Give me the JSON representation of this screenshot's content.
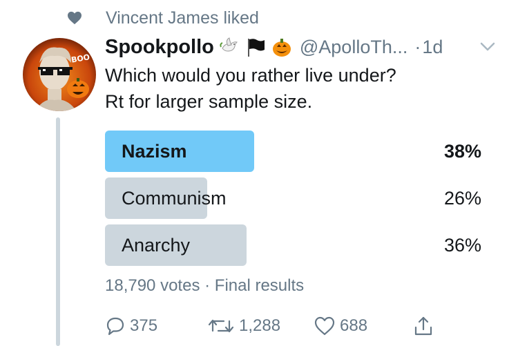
{
  "context": {
    "text": "Vincent James liked",
    "icon": "heart-icon"
  },
  "tweet": {
    "display_name": "Spookpollo",
    "emojis": [
      "dove-emoji",
      "black-flag-emoji",
      "jack-o-lantern-emoji"
    ],
    "handle": "@ApolloTh...",
    "dot": "·",
    "time": "1d",
    "text_line1": "Which would you rather live under?",
    "text_line2": "Rt for larger sample size.",
    "avatar_text": "BOO"
  },
  "poll": {
    "options": [
      {
        "label": "Nazism",
        "percent_label": "38%",
        "percent": 38,
        "winner": true
      },
      {
        "label": "Communism",
        "percent_label": "26%",
        "percent": 26,
        "winner": false
      },
      {
        "label": "Anarchy",
        "percent_label": "36%",
        "percent": 36,
        "winner": false
      }
    ],
    "votes": "18,790 votes",
    "separator": "·",
    "status": "Final results"
  },
  "actions": {
    "replies": "375",
    "retweets": "1,288",
    "likes": "688"
  },
  "colors": {
    "winner_bar": "#71c9f8",
    "bar": "#ccd6dd",
    "muted_text": "#657786",
    "text": "#14171a"
  }
}
